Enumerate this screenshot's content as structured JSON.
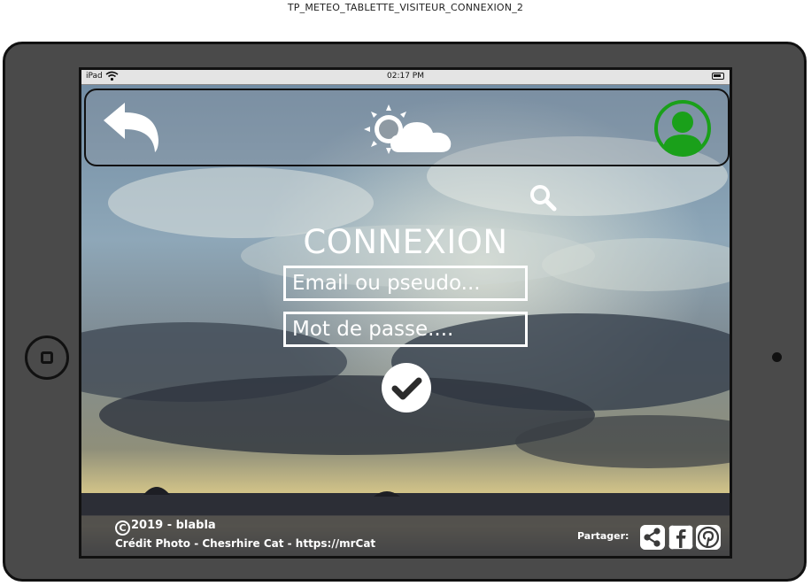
{
  "document": {
    "title": "TP_METEO_TABLETTE_VISITEUR_CONNEXION_2"
  },
  "status_bar": {
    "carrier": "iPad",
    "time": "02:17 PM"
  },
  "header": {
    "back_icon": "back-arrow-icon",
    "logo_icon": "sun-cloud-icon",
    "profile_icon": "user-profile-icon",
    "profile_color": "#1aa01a"
  },
  "search": {
    "icon": "search-icon"
  },
  "login": {
    "title": "CONNEXION",
    "email_placeholder": "Email ou pseudo...",
    "password_placeholder": "Mot de passe....",
    "submit_icon": "check-circle-icon"
  },
  "footer": {
    "copyright": "2019 - blabla",
    "photo_credit": "Crédit Photo - Chesrhire Cat - https://mrCat",
    "share_label": "Partager:",
    "share_buttons": [
      "share-icon",
      "facebook-icon",
      "pinterest-icon"
    ]
  }
}
